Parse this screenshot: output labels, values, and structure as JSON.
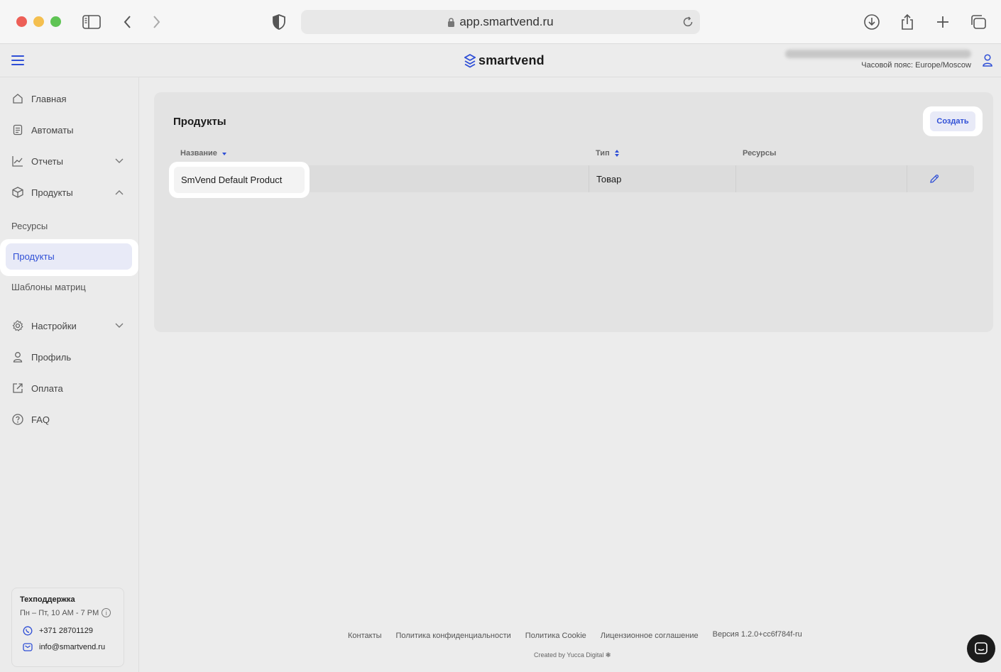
{
  "browser": {
    "url": "app.smartvend.ru"
  },
  "header": {
    "logo_text": "smartvend",
    "timezone": "Часовой пояс: Europe/Moscow"
  },
  "sidebar": {
    "items": [
      {
        "label": "Главная",
        "icon": "home-icon"
      },
      {
        "label": "Автоматы",
        "icon": "list-icon"
      },
      {
        "label": "Отчеты",
        "icon": "chart-icon"
      },
      {
        "label": "Продукты",
        "icon": "box-icon"
      }
    ],
    "sub_items": [
      {
        "label": "Ресурсы"
      },
      {
        "label": "Продукты",
        "active": true
      },
      {
        "label": "Шаблоны матриц"
      }
    ],
    "bottom_items": [
      {
        "label": "Настройки",
        "icon": "gear-icon"
      },
      {
        "label": "Профиль",
        "icon": "user-icon"
      },
      {
        "label": "Оплата",
        "icon": "external-link-icon"
      },
      {
        "label": "FAQ",
        "icon": "question-icon"
      }
    ],
    "support": {
      "title": "Техподдержка",
      "hours": "Пн – Пт, 10 AM - 7 PM",
      "phone": "+371 28701129",
      "email": "info@smartvend.ru"
    }
  },
  "main": {
    "title": "Продукты",
    "create_label": "Создать",
    "columns": [
      "Название",
      "Тип",
      "Ресурсы"
    ],
    "rows": [
      {
        "name": "SmVend Default Product",
        "type": "Товар",
        "resources": ""
      }
    ]
  },
  "footer": {
    "links": [
      "Контакты",
      "Политика конфиденциальности",
      "Политика Cookie",
      "Лицензионное соглашение"
    ],
    "version": "Версия 1.2.0+cc6f784f-ru",
    "created_by": "Created by Yucca Digital ❃"
  },
  "colors": {
    "accent": "#2f4fd6"
  }
}
